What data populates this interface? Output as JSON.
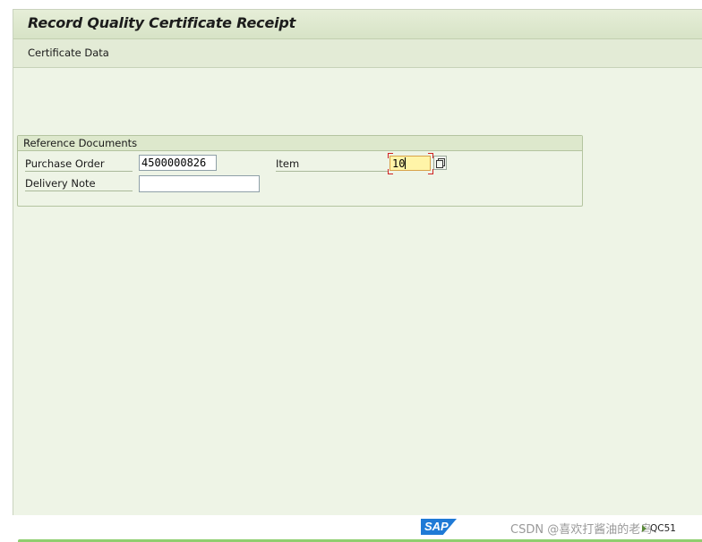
{
  "title": "Record Quality Certificate Receipt",
  "toolbar": {
    "certificate_data": "Certificate Data"
  },
  "reference_documents": {
    "title": "Reference Documents",
    "purchase_order_label": "Purchase Order",
    "purchase_order_value": "4500000826",
    "item_label": "Item",
    "item_value": "10",
    "delivery_note_label": "Delivery Note",
    "delivery_note_value": ""
  },
  "status_bar": {
    "logo_text": "SAP",
    "watermark": "CSDN @喜欢打酱油的老鸟",
    "transaction": "QC51"
  },
  "colors": {
    "background": "#eef4e6",
    "focused_field": "#fff4a8",
    "sap_logo": "#1f7ad6",
    "status_stripe": "#8fce6f"
  }
}
